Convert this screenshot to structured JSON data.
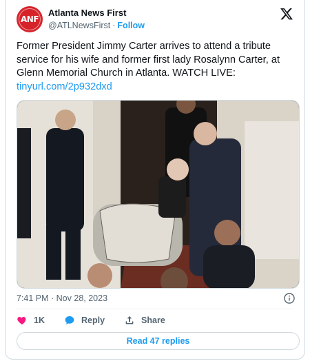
{
  "account": {
    "avatar_text": "ANF",
    "name": "Atlanta News First",
    "handle": "@ATLNewsFirst",
    "separator": "·",
    "follow_label": "Follow"
  },
  "tweet": {
    "text": "Former President Jimmy Carter arrives to attend a tribute service for his wife and former first lady Rosalynn Carter, at Glenn Memorial Church in Atlanta. WATCH LIVE:",
    "link": "tinyurl.com/2p932dxd",
    "timestamp": "7:41 PM · Nov 28, 2023"
  },
  "actions": {
    "like_count": "1K",
    "reply_label": "Reply",
    "share_label": "Share",
    "read_replies_label": "Read 47 replies"
  },
  "colors": {
    "accent": "#1d9bf0",
    "like": "#f91880",
    "brand": "#d6232a"
  },
  "icons": {
    "brand": "x-logo-icon",
    "info": "info-icon",
    "like": "heart-icon",
    "reply": "reply-bubble-icon",
    "share": "share-icon"
  }
}
